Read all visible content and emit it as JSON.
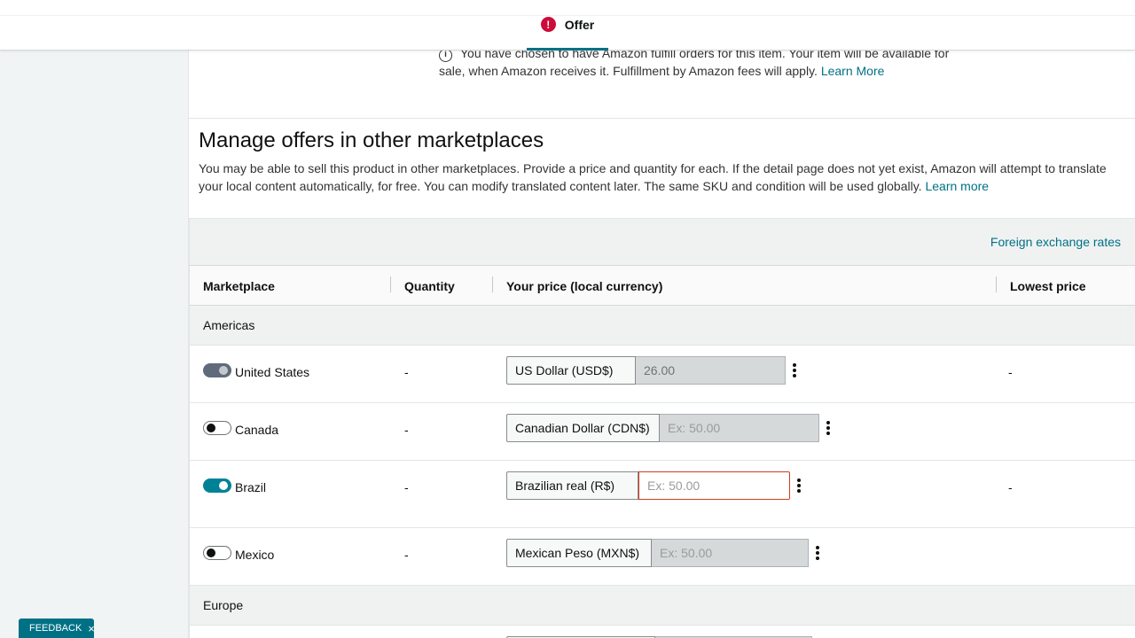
{
  "header": {
    "tab_label": "Offer",
    "tab_status_icon": "error-icon"
  },
  "fba_note": {
    "text": "You have chosen to have Amazon fulfill orders for this item. Your item will be available for sale, when Amazon receives it. Fulfillment by Amazon fees will apply.",
    "link": "Learn More"
  },
  "section": {
    "title": "Manage offers in other marketplaces",
    "description": "You may be able to sell this product in other marketplaces. Provide a price and quantity for each. If the detail page does not yet exist, Amazon will attempt to translate your local content automatically, for free. You can modify translated content later. The same SKU and condition will be used globally.",
    "link": "Learn more"
  },
  "table": {
    "fx_link": "Foreign exchange rates",
    "columns": {
      "marketplace": "Marketplace",
      "quantity": "Quantity",
      "price": "Your price (local currency)",
      "lowest": "Lowest price"
    },
    "groups": {
      "americas": "Americas",
      "europe": "Europe"
    },
    "rows": [
      {
        "country": "United States",
        "toggle": "on-disabled",
        "quantity": "-",
        "currency": "US Dollar (USD$)",
        "price_value": "26.00",
        "price_placeholder": "",
        "lowest": "-"
      },
      {
        "country": "Canada",
        "toggle": "off",
        "quantity": "-",
        "currency": "Canadian Dollar (CDN$)",
        "price_value": "",
        "price_placeholder": "Ex: 50.00",
        "lowest": ""
      },
      {
        "country": "Brazil",
        "toggle": "on",
        "quantity": "-",
        "currency": "Brazilian real (R$)",
        "price_value": "",
        "price_placeholder": "Ex: 50.00",
        "lowest": "-"
      },
      {
        "country": "Mexico",
        "toggle": "off",
        "quantity": "-",
        "currency": "Mexican Peso (MXN$)",
        "price_value": "",
        "price_placeholder": "Ex: 50.00",
        "lowest": ""
      }
    ]
  },
  "feedback": {
    "label": "FEEDBACK",
    "close": "×"
  },
  "colors": {
    "accent": "#007185",
    "error": "#cc0c39",
    "toggle_on": "#008296",
    "invalid_border": "#cc3e1f"
  }
}
